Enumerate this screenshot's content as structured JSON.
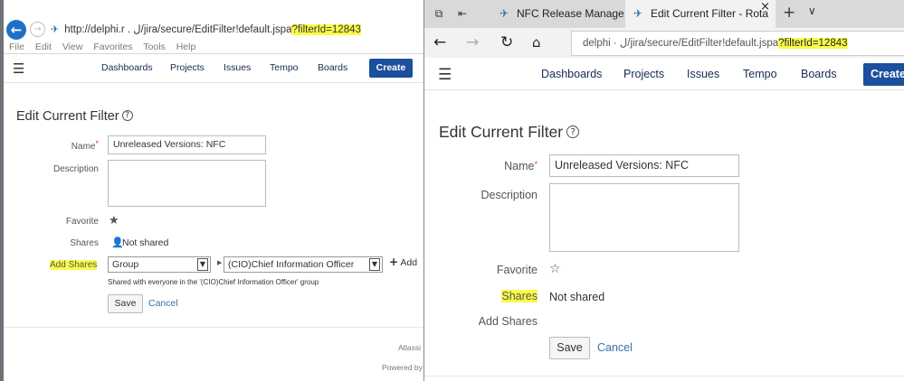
{
  "left_window": {
    "url": {
      "text": "http://delphi.r        .            ل/jira/secure/EditFilter!default.jspa",
      "highlight": "?filterId=12843"
    },
    "menu": [
      "File",
      "Edit",
      "View",
      "Favorites",
      "Tools",
      "Help"
    ],
    "nav": {
      "items": [
        "Dashboards",
        "Projects",
        "Issues",
        "Tempo",
        "Boards"
      ],
      "create": "Create"
    },
    "page_title": "Edit Current Filter",
    "form": {
      "name_label": "Name",
      "name_value": "Unreleased Versions: NFC",
      "description_label": "Description",
      "favorite_label": "Favorite",
      "shares_label": "Shares",
      "shares_value": "Not shared",
      "add_shares_label": "Add Shares",
      "share_type": "Group",
      "share_group": "(CIO)Chief Information Officer",
      "add_label": "Add",
      "hint": "Shared with everyone in the '(CIO)Chief Information Officer' group",
      "save": "Save",
      "cancel": "Cancel"
    },
    "footer": [
      "Atlassi",
      "Powered by"
    ]
  },
  "right_window": {
    "tabs": [
      {
        "title": "NFC Release Management E"
      },
      {
        "title": "Edit Current Filter - Rota",
        "close": "×"
      }
    ],
    "url": {
      "text": "delphi ·           ل/jira/secure/EditFilter!default.jspa",
      "highlight": "?filterId=12843"
    },
    "nav": {
      "items": [
        "Dashboards",
        "Projects",
        "Issues",
        "Tempo",
        "Boards"
      ],
      "create": "Create"
    },
    "page_title": "Edit Current Filter",
    "form": {
      "name_label": "Name",
      "name_value": "Unreleased Versions: NFC",
      "description_label": "Description",
      "favorite_label": "Favorite",
      "shares_label": "Shares",
      "shares_value": "Not shared",
      "add_shares_label": "Add Shares",
      "save": "Save",
      "cancel": "Cancel"
    }
  },
  "icons": {
    "back": "back-arrow-icon",
    "forward": "forward-arrow-icon",
    "refresh": "refresh-icon",
    "home": "home-icon",
    "menu": "hamburger-icon",
    "help": "help-icon",
    "favorite": "star-icon",
    "person": "person-icon",
    "add": "plus-icon"
  },
  "colors": {
    "highlight": "#fbfb4a",
    "create_button": "#1c4f9c",
    "link": "#3572b0",
    "required": "#d04437"
  }
}
